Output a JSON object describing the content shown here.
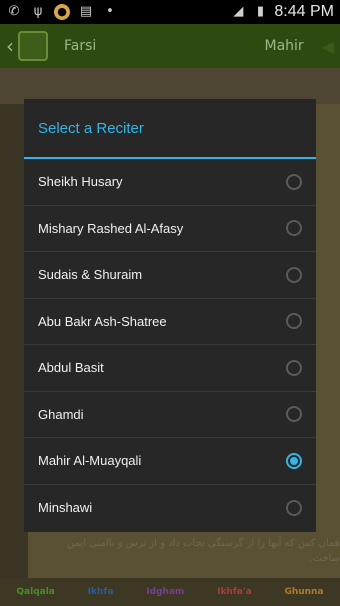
{
  "status_bar": {
    "time": "8:44 PM",
    "icons": [
      "whatsapp-icon",
      "usb-icon",
      "notification-icon",
      "sdcard-icon",
      "dot-icon",
      "signal-icon",
      "battery-icon"
    ]
  },
  "app_bar": {
    "language": "Farsi",
    "reciter": "Mahir"
  },
  "dialog": {
    "title": "Select a Reciter",
    "accent_color": "#33b5e5",
    "options": [
      {
        "label": "Sheikh Husary",
        "selected": false
      },
      {
        "label": "Mishary Rashed Al-Afasy",
        "selected": false
      },
      {
        "label": "Sudais & Shuraim",
        "selected": false
      },
      {
        "label": "Abu Bakr Ash-Shatree",
        "selected": false
      },
      {
        "label": "Abdul Basit",
        "selected": false
      },
      {
        "label": "Ghamdi",
        "selected": false
      },
      {
        "label": "Mahir Al-Muayqali",
        "selected": true
      },
      {
        "label": "Minshawi",
        "selected": false
      }
    ]
  },
  "background": {
    "translation_text": "همان کس که آنها را از گرسنگی نجات داد و از ترس و ناامنی ایمن ساخت.",
    "tajweed_legend": [
      {
        "label": "Qalqala",
        "color": "#4c8a2a"
      },
      {
        "label": "Ikhfa",
        "color": "#2a5a9a"
      },
      {
        "label": "Idgham",
        "color": "#7a3a9a"
      },
      {
        "label": "Ikhfa'a",
        "color": "#b03a3a"
      },
      {
        "label": "Ghunna",
        "color": "#b07a2a"
      }
    ]
  }
}
